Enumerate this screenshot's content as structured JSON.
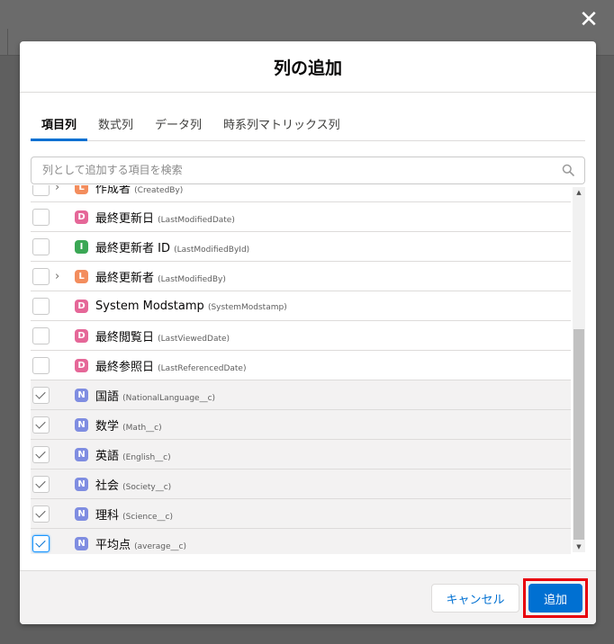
{
  "modal": {
    "title": "列の追加",
    "close_icon": "close-icon"
  },
  "tabs": [
    {
      "label": "項目列",
      "active": true
    },
    {
      "label": "数式列",
      "active": false
    },
    {
      "label": "データ列",
      "active": false
    },
    {
      "label": "時系列マトリックス列",
      "active": false
    }
  ],
  "search": {
    "placeholder": "列として追加する項目を検索"
  },
  "fields": [
    {
      "label": "作成者",
      "api": "(CreatedBy)",
      "type": "L",
      "checked": false,
      "expandable": true
    },
    {
      "label": "最終更新日",
      "api": "(LastModifiedDate)",
      "type": "D",
      "checked": false,
      "expandable": false
    },
    {
      "label": "最終更新者 ID",
      "api": "(LastModifiedById)",
      "type": "I",
      "checked": false,
      "expandable": false
    },
    {
      "label": "最終更新者",
      "api": "(LastModifiedBy)",
      "type": "L",
      "checked": false,
      "expandable": true
    },
    {
      "label": "System Modstamp",
      "api": "(SystemModstamp)",
      "type": "D",
      "checked": false,
      "expandable": false
    },
    {
      "label": "最終閲覧日",
      "api": "(LastViewedDate)",
      "type": "D",
      "checked": false,
      "expandable": false
    },
    {
      "label": "最終参照日",
      "api": "(LastReferencedDate)",
      "type": "D",
      "checked": false,
      "expandable": false
    },
    {
      "label": "国語",
      "api": "(NationalLanguage__c)",
      "type": "N",
      "checked": true,
      "expandable": false
    },
    {
      "label": "数学",
      "api": "(Math__c)",
      "type": "N",
      "checked": true,
      "expandable": false
    },
    {
      "label": "英語",
      "api": "(English__c)",
      "type": "N",
      "checked": true,
      "expandable": false
    },
    {
      "label": "社会",
      "api": "(Society__c)",
      "type": "N",
      "checked": true,
      "expandable": false
    },
    {
      "label": "理科",
      "api": "(Science__c)",
      "type": "N",
      "checked": true,
      "expandable": false
    },
    {
      "label": "平均点",
      "api": "(average__c)",
      "type": "N",
      "checked": true,
      "expandable": false,
      "focused": true
    }
  ],
  "badge_colors": {
    "L": "#f38d5d",
    "D": "#e56798",
    "I": "#3ba755",
    "N": "#7f8de1"
  },
  "footer": {
    "cancel_label": "キャンセル",
    "add_label": "追加"
  }
}
